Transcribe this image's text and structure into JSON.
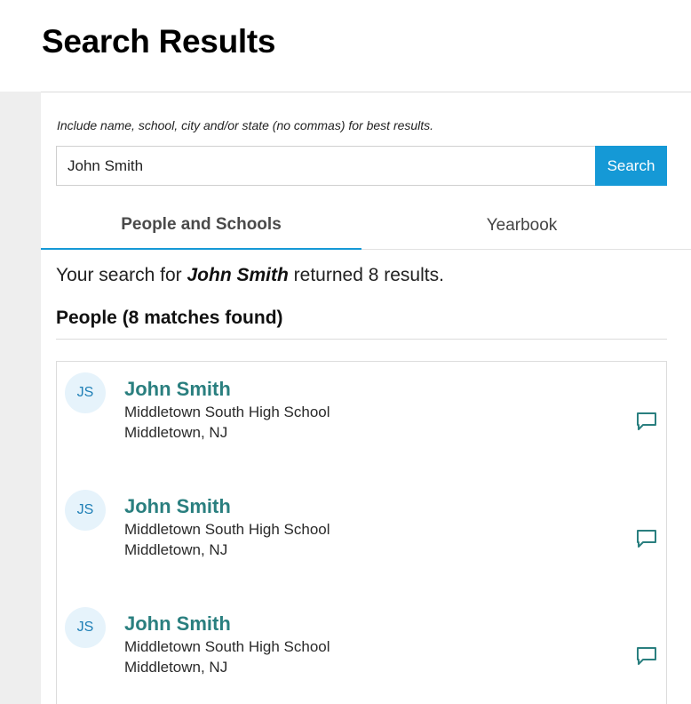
{
  "page": {
    "title": "Search Results"
  },
  "search": {
    "hint": "Include name, school, city and/or state (no commas) for best results.",
    "value": "John Smith",
    "button_label": "Search"
  },
  "tabs": [
    {
      "label": "People and Schools",
      "active": true
    },
    {
      "label": "Yearbook",
      "active": false
    }
  ],
  "summary": {
    "prefix": "Your search for ",
    "query": "John Smith",
    "suffix": " returned 8 results."
  },
  "people_heading": "People (8 matches found)",
  "results": [
    {
      "initials": "JS",
      "name": "John Smith",
      "school": "Middletown South High School",
      "location": "Middletown, NJ",
      "action_icon": "message-icon"
    },
    {
      "initials": "JS",
      "name": "John Smith",
      "school": "Middletown South High School",
      "location": "Middletown, NJ",
      "action_icon": "message-icon"
    },
    {
      "initials": "JS",
      "name": "John Smith",
      "school": "Middletown South High School",
      "location": "Middletown, NJ",
      "action_icon": "message-icon"
    }
  ],
  "colors": {
    "accent": "#1599d6",
    "name_link": "#2a7f7f",
    "avatar_bg": "#e6f3fb",
    "avatar_text": "#1e7fb6"
  }
}
